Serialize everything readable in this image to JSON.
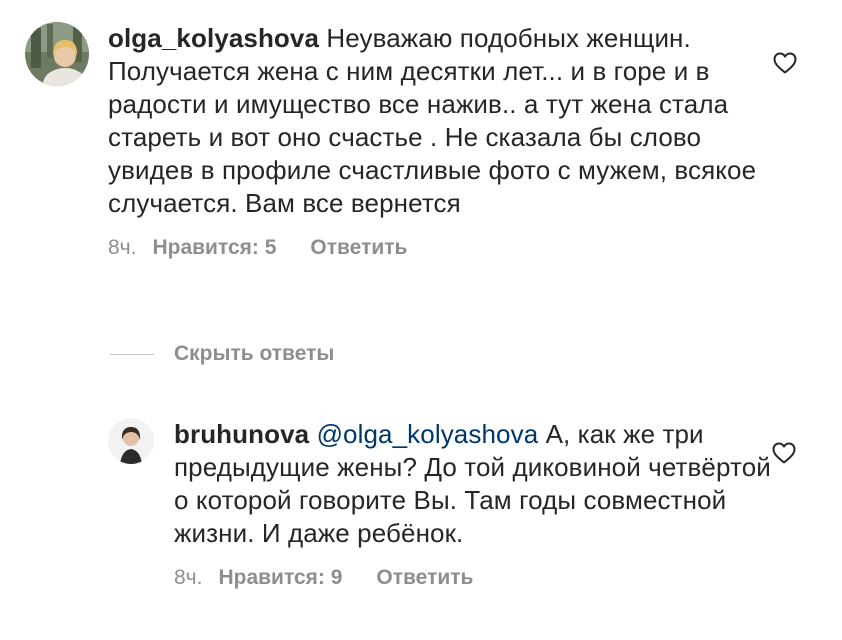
{
  "comments": [
    {
      "username": "olga_kolyashova",
      "mention": "",
      "text": "Неуважаю подобных женщин. Получается жена с ним десятки лет... и в горе и в радости и имущество все нажив.. а тут жена стала стареть и вот оно счастье . Не сказала бы слово увидев в профиле счастливые фото с мужем, всякое случается. Вам все вернется",
      "time": "8ч.",
      "likes": "Нравится: 5",
      "reply": "Ответить"
    },
    {
      "username": "bruhunova",
      "mention": "@olga_kolyashova",
      "text": "А, как же три предыдущие жены? До той диковиной четвёртой о которой говорите Вы. Там годы совместной жизни. И даже ребёнок.",
      "time": "8ч.",
      "likes": "Нравится: 9",
      "reply": "Ответить"
    }
  ],
  "hide_replies": "Скрыть ответы",
  "icons": {
    "like": "heart-outline-icon"
  },
  "colors": {
    "text": "#262626",
    "meta": "#8e8e8e",
    "mention": "#00376b"
  }
}
